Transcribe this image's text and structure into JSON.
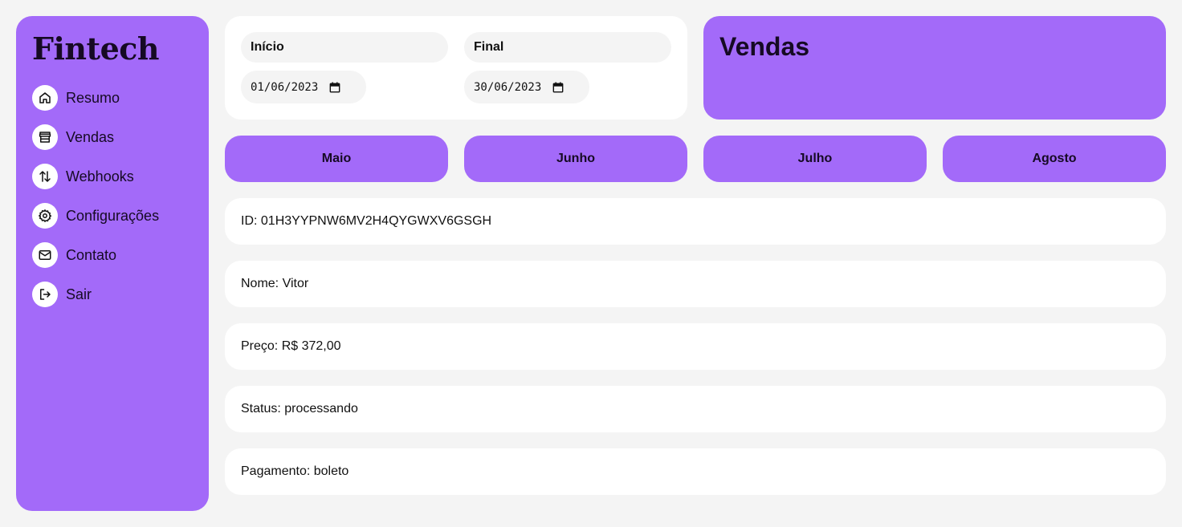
{
  "sidebar": {
    "logo": "Fintech",
    "items": [
      {
        "label": "Resumo",
        "icon": "home-icon"
      },
      {
        "label": "Vendas",
        "icon": "store-icon"
      },
      {
        "label": "Webhooks",
        "icon": "arrows-up-down-icon"
      },
      {
        "label": "Configurações",
        "icon": "gear-icon"
      },
      {
        "label": "Contato",
        "icon": "mail-icon"
      },
      {
        "label": "Sair",
        "icon": "logout-icon"
      }
    ]
  },
  "filters": {
    "start_label": "Início",
    "start_value": "01/06/2023",
    "end_label": "Final",
    "end_value": "30/06/2023"
  },
  "header": {
    "title": "Vendas"
  },
  "months": [
    "Maio",
    "Junho",
    "Julho",
    "Agosto"
  ],
  "sale": {
    "id": "ID: 01H3YYPNW6MV2H4QYGWXV6GSGH",
    "name": "Nome: Vitor",
    "price": "Preço: R$ 372,00",
    "status": "Status: processando",
    "payment": "Pagamento: boleto"
  },
  "colors": {
    "accent": "#a36af9",
    "background": "#f4f4f4",
    "card": "#ffffff",
    "text_dark": "#160a24"
  }
}
